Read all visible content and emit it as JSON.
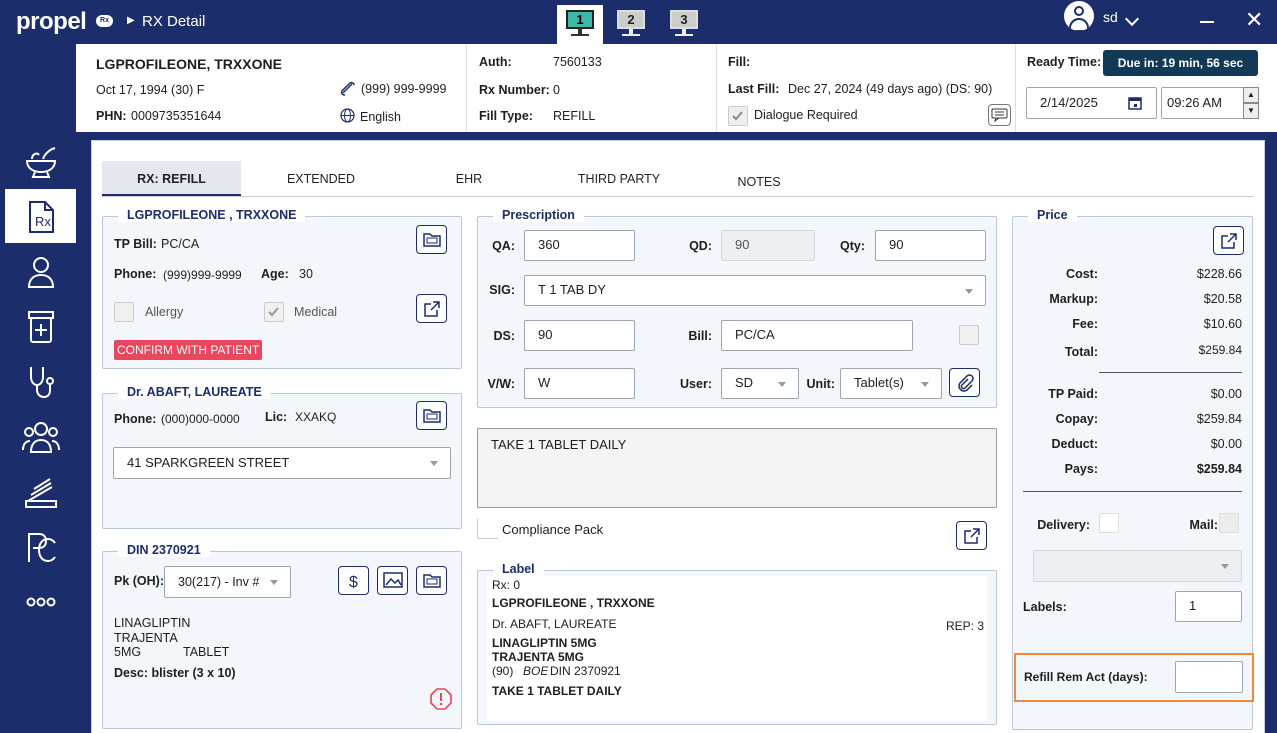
{
  "topbar": {
    "logo": "propel",
    "logo_badge": "Rx",
    "breadcrumb": "RX Detail",
    "monitors": [
      "1",
      "2",
      "3"
    ],
    "user": "sd"
  },
  "sidebar": {
    "items": [
      "mortar-pestle-icon",
      "rx-icon",
      "patient-icon",
      "medicine-icon",
      "stethoscope-icon",
      "group-icon",
      "scanner-icon",
      "pc-icon",
      "more-icon"
    ]
  },
  "header": {
    "patient_name": "LGPROFILEONE, TRXXONE",
    "dob": "Oct 17, 1994 (30) F",
    "phn_label": "PHN:",
    "phn": "0009735351644",
    "phone": "(999) 999-9999",
    "language": "English",
    "auth_label": "Auth:",
    "auth": "7560133",
    "rx_number_label": "Rx Number:",
    "rx_number": "0",
    "fill_type_label": "Fill Type:",
    "fill_type": "REFILL",
    "fill_label": "Fill:",
    "last_fill_label": "Last Fill:",
    "last_fill": "Dec 27, 2024 (49 days ago) (DS: 90)",
    "dialogue_required": "Dialogue Required",
    "ready_time_label": "Ready Time:",
    "due_badge": "Due in: 19 min, 56 sec",
    "ready_date": "2/14/2025",
    "ready_time": "09:26 AM"
  },
  "tabs": [
    "RX: REFILL",
    "EXTENDED",
    "EHR",
    "THIRD PARTY",
    "NOTES"
  ],
  "patient_panel": {
    "title": "LGPROFILEONE , TRXXONE",
    "tp_bill_label": "TP Bill:",
    "tp_bill": "PC/CA",
    "phone_label": "Phone:",
    "phone": "(999)999-9999",
    "age_label": "Age:",
    "age": "30",
    "allergy": "Allergy",
    "medical": "Medical",
    "confirm": "CONFIRM WITH PATIENT"
  },
  "doctor_panel": {
    "title": "Dr. ABAFT, LAUREATE",
    "phone_label": "Phone:",
    "phone": "(000)000-0000",
    "lic_label": "Lic:",
    "lic": "XXAKQ",
    "address": "41 SPARKGREEN STREET"
  },
  "din_panel": {
    "title": "DIN 2370921",
    "pk_label": "Pk (OH):",
    "pk_value": "30(217) - Inv #",
    "line1": "LINAGLIPTIN",
    "line2": "TRAJENTA",
    "line3": "5MG",
    "line3b": "TABLET",
    "desc": "Desc: blister (3 x 10)"
  },
  "prescription": {
    "title": "Prescription",
    "qa_label": "QA:",
    "qa": "360",
    "qd_label": "QD:",
    "qd": "90",
    "qty_label": "Qty:",
    "qty": "90",
    "sig_label": "SIG:",
    "sig": "T 1 TAB DY",
    "ds_label": "DS:",
    "ds": "90",
    "bill_label": "Bill:",
    "bill": "PC/CA",
    "vw_label": "V/W:",
    "vw": "W",
    "user_label": "User:",
    "user": "SD",
    "unit_label": "Unit:",
    "unit": "Tablet(s)",
    "sig_text": "TAKE 1 TABLET DAILY",
    "compliance": "Compliance Pack"
  },
  "label": {
    "title": "Label",
    "rx": "Rx: 0",
    "patient": "LGPROFILEONE ,  TRXXONE",
    "doctor": "Dr. ABAFT, LAUREATE",
    "rep": "REP: 3",
    "drug1": "LINAGLIPTIN 5MG",
    "drug2": "TRAJENTA 5MG",
    "qty": "(90)",
    "boe": "BOE",
    "din": "DIN 2370921",
    "directions": "TAKE 1 TABLET DAILY"
  },
  "price": {
    "title": "Price",
    "cost_label": "Cost:",
    "cost": "$228.66",
    "markup_label": "Markup:",
    "markup": "$20.58",
    "fee_label": "Fee:",
    "fee": "$10.60",
    "total_label": "Total:",
    "total": "$259.84",
    "tp_paid_label": "TP Paid:",
    "tp_paid": "$0.00",
    "copay_label": "Copay:",
    "copay": "$259.84",
    "deduct_label": "Deduct:",
    "deduct": "$0.00",
    "pays_label": "Pays:",
    "pays": "$259.84",
    "delivery_label": "Delivery:",
    "mail_label": "Mail:",
    "labels_label": "Labels:",
    "labels": "1",
    "refill_label": "Refill Rem Act (days):",
    "refill_value": ""
  },
  "colors": {
    "navy": "#1b2d6b",
    "accent": "#3db8a8",
    "alert": "#e8475d",
    "highlight": "#f0893a",
    "due_badge": "#123a56"
  }
}
